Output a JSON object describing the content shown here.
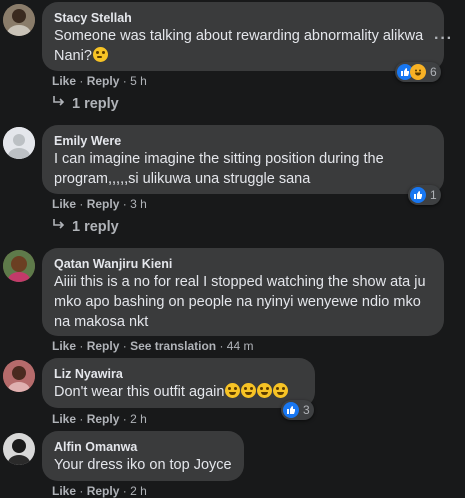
{
  "comments": [
    {
      "author": "Stacy Stellah",
      "text": "Someone was talking about rewarding abnormality alikwa Nani?",
      "like_label": "Like",
      "reply_label": "Reply",
      "time": "5 h",
      "reaction_count": "6",
      "reactions": [
        "like-icon",
        "haha-icon"
      ],
      "replies_label": "1 reply"
    },
    {
      "author": "Emily Were",
      "text": "I can imagine imagine the sitting position during the program,,,,,si ulikuwa una struggle sana",
      "like_label": "Like",
      "reply_label": "Reply",
      "time": "3 h",
      "reaction_count": "1",
      "reactions": [
        "like-icon"
      ],
      "replies_label": "1 reply"
    },
    {
      "author": "Qatan Wanjiru Kieni",
      "text": "Aiiii this is a no for real I stopped watching the show ata ju mko apo bashing on people na nyinyi wenyewe ndio mko na makosa nkt",
      "like_label": "Like",
      "reply_label": "Reply",
      "translation_label": "See translation",
      "time": "44 m"
    },
    {
      "author": "Liz Nyawira",
      "text": "Don't wear this outfit again",
      "like_label": "Like",
      "reply_label": "Reply",
      "time": "2 h",
      "reaction_count": "3",
      "reactions": [
        "like-icon"
      ]
    },
    {
      "author": "Alfin Omanwa",
      "text": "Your dress iko on top Joyce",
      "like_label": "Like",
      "reply_label": "Reply",
      "time": "2 h"
    }
  ],
  "separator": "·",
  "more_label": "···",
  "colors": {
    "background": "#18191a",
    "bubble": "#3a3b3c",
    "like_blue": "#1877f2",
    "haha_yellow": "#f7b125",
    "secondary_text": "#b0b3b8"
  }
}
